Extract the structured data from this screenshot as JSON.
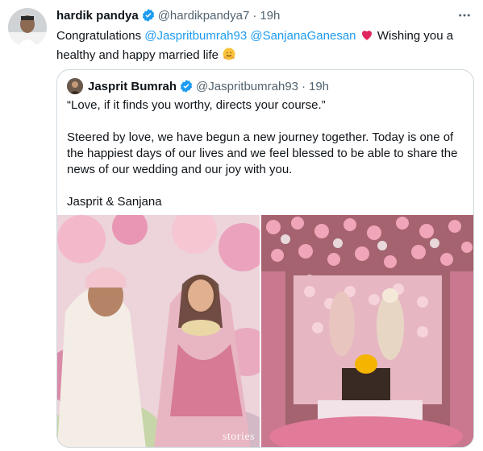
{
  "tweet": {
    "author_name": "hardik pandya",
    "handle": "@hardikpandya7",
    "time": "19h",
    "text_prefix": "Congratulations ",
    "mention1": "@Jaspritbumrah93",
    "mention2": "@SanjanaGanesan",
    "text_suffix": " Wishing you a healthy and happy married life",
    "heart_emoji": "red-heart",
    "hug_emoji": "hugging-face"
  },
  "quote": {
    "author_name": "Jasprit Bumrah",
    "handle": "@Jaspritbumrah93",
    "time": "19h",
    "line1": "“Love, if it finds you worthy, directs your course.”",
    "line2": "Steered by love, we have begun a new journey together. Today is one of the happiest days of our lives and we feel blessed to be able to share the news of our wedding and our joy with you.",
    "line3": "Jasprit & Sanjana",
    "photo_left_watermark": "stories",
    "accent_color": "#1d9bf0"
  },
  "colors": {
    "verified": "#1d9bf0",
    "heart": "#e0245e",
    "mention": "#1d9bf0"
  }
}
